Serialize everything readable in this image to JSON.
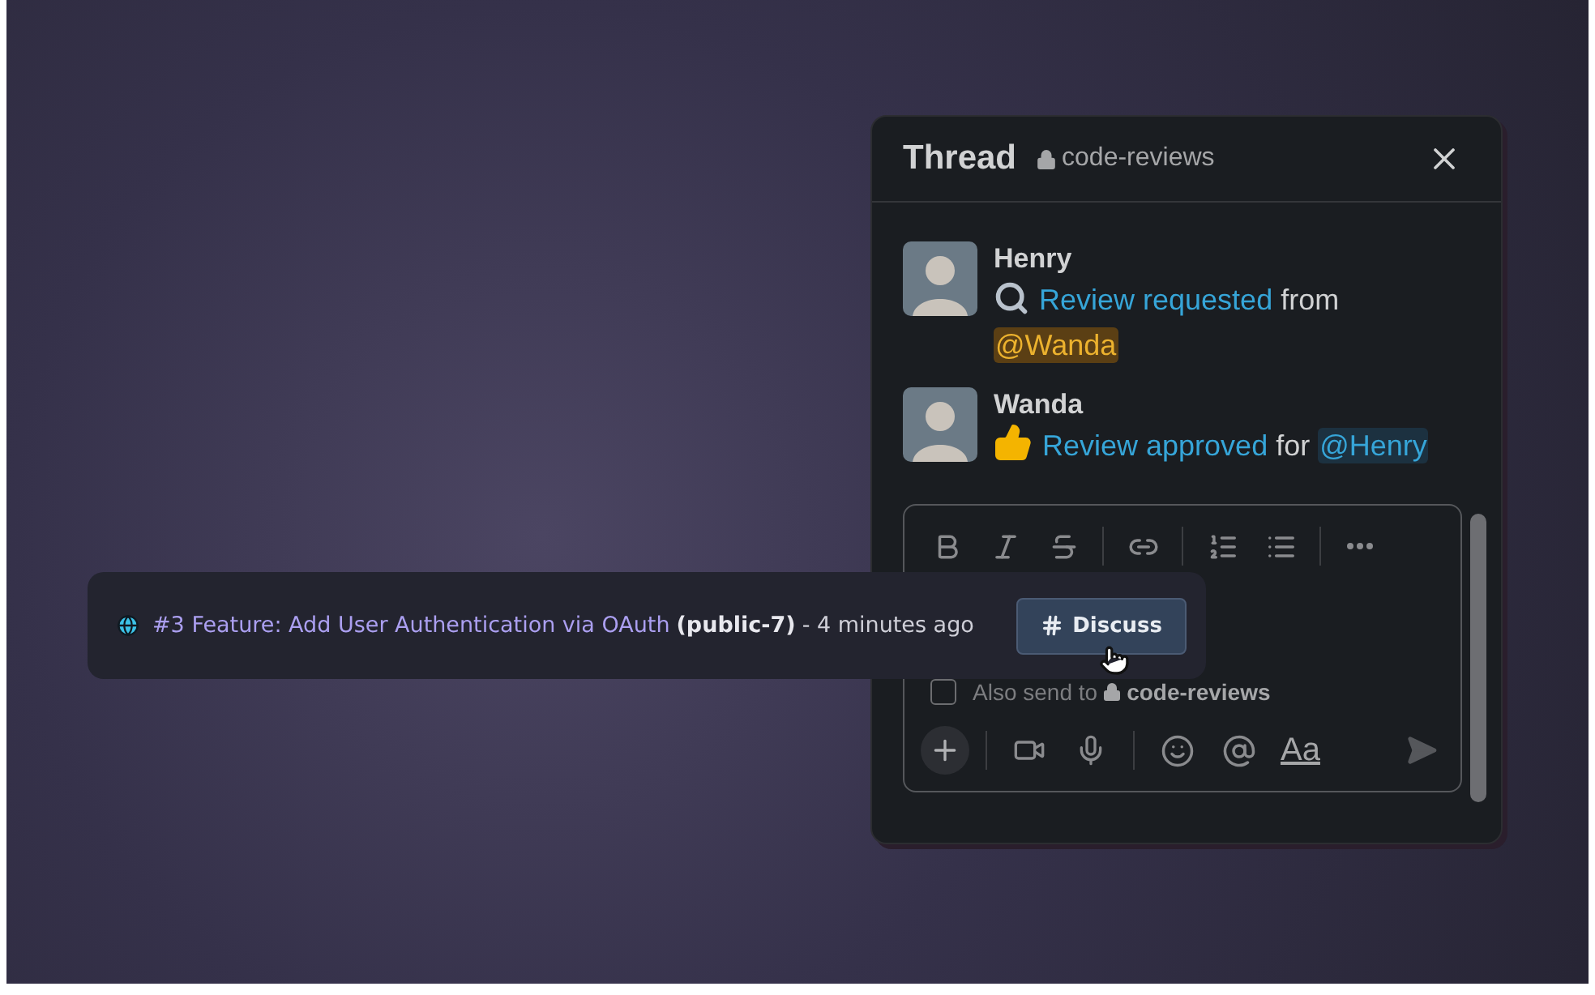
{
  "thread": {
    "title": "Thread",
    "channel": "code-reviews",
    "messages": [
      {
        "author": "Henry",
        "kind": "request",
        "link": "Review requested",
        "connector": "from",
        "mention": "@Wanda",
        "highlighted": true
      },
      {
        "author": "Wanda",
        "kind": "approval",
        "link": "Review approved",
        "connector": "for",
        "mention": "@Henry",
        "highlighted": false
      }
    ],
    "composer": {
      "also_send": {
        "label": "Also send to",
        "channel": "code-reviews",
        "checked": false
      },
      "format_label": "Aa",
      "send_disabled": true
    }
  },
  "notification": {
    "title": "#3 Feature: Add User Authentication via OAuth",
    "repo": "(public-7)",
    "time": "- 4 minutes ago",
    "button": "Discuss"
  }
}
